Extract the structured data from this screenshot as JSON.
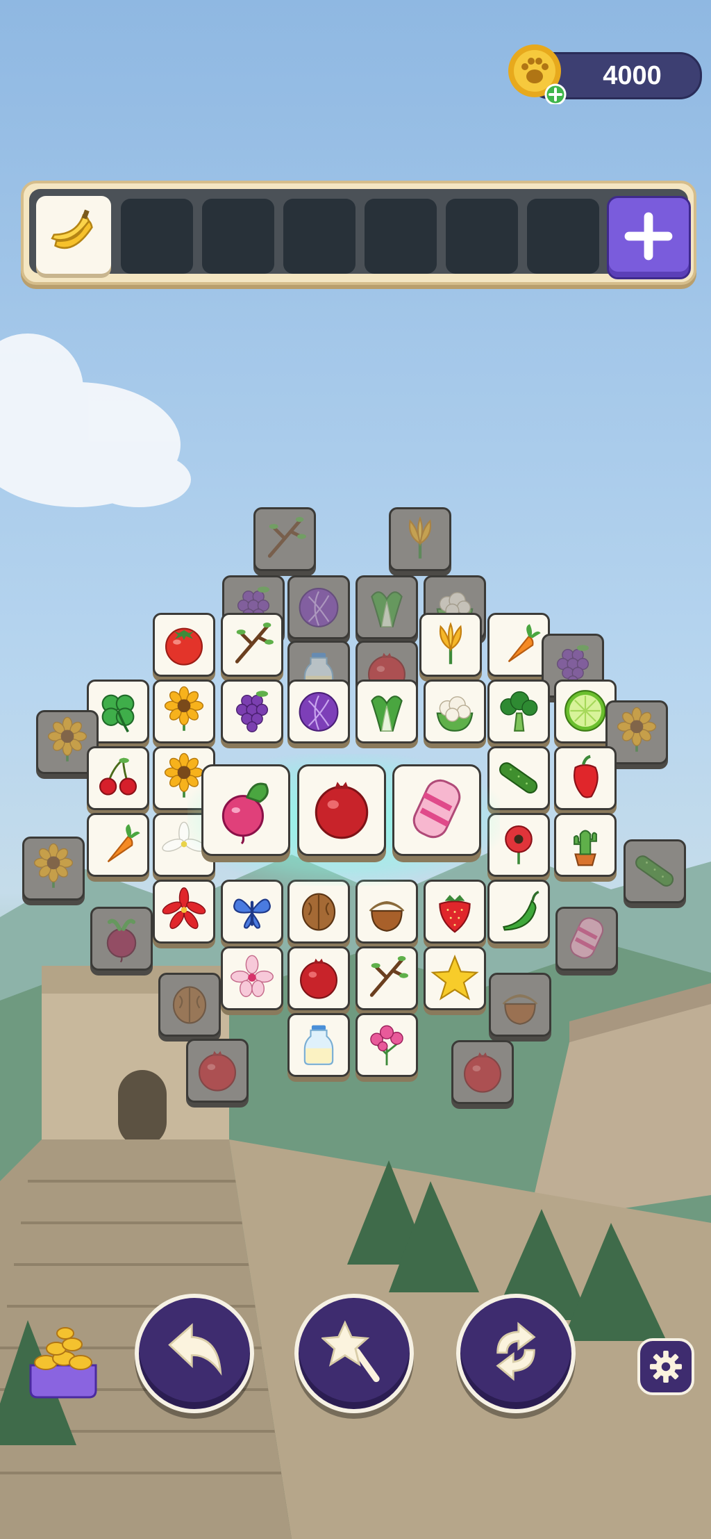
{
  "hud": {
    "coins": "4000",
    "coin_icon": "paw-coin-icon",
    "add_coins_icon": "plus-icon"
  },
  "tray": {
    "slots_total": 7,
    "filled": [
      {
        "item": "banana"
      }
    ],
    "add_slot_icon": "plus-icon"
  },
  "board": {
    "selected_tiles": [
      "radish",
      "pomegranate",
      "marshmallow"
    ],
    "tile_items": [
      "branch",
      "crocus",
      "grapes",
      "cabbage",
      "bok-choy",
      "cauliflower",
      "tomato",
      "branch",
      "milk-bottle",
      "pomegranate",
      "crocus",
      "carrot",
      "grapes",
      "clover",
      "sunflower",
      "grapes",
      "cabbage",
      "bok-choy",
      "cauliflower",
      "broccoli",
      "lime",
      "sunflower",
      "sunflower",
      "cherries",
      "sunflower",
      "cucumber",
      "bell-pepper",
      "carrot",
      "lily",
      "rose",
      "cactus",
      "sunflower",
      "cucumber",
      "beet",
      "red-lily",
      "butterfly",
      "walnut",
      "hazelnut",
      "strawberry",
      "chili-pepper",
      "marshmallow",
      "walnut",
      "orchid",
      "pomegranate",
      "branch",
      "star-fruit",
      "hazelnut",
      "pomegranate",
      "milk-bottle",
      "pink-flowers",
      "pomegranate"
    ]
  },
  "controls": {
    "undo": "undo-arrow-icon",
    "magic_wand": "magic-wand-icon",
    "shuffle": "shuffle-icon",
    "settings": "gear-icon",
    "shop": "coin-pot-icon"
  },
  "colors": {
    "tray_bg": "#f4e6c2",
    "control_bg": "#3e2c6f",
    "add_slot": "#7a5cdc",
    "glow": "#82ffe6"
  }
}
